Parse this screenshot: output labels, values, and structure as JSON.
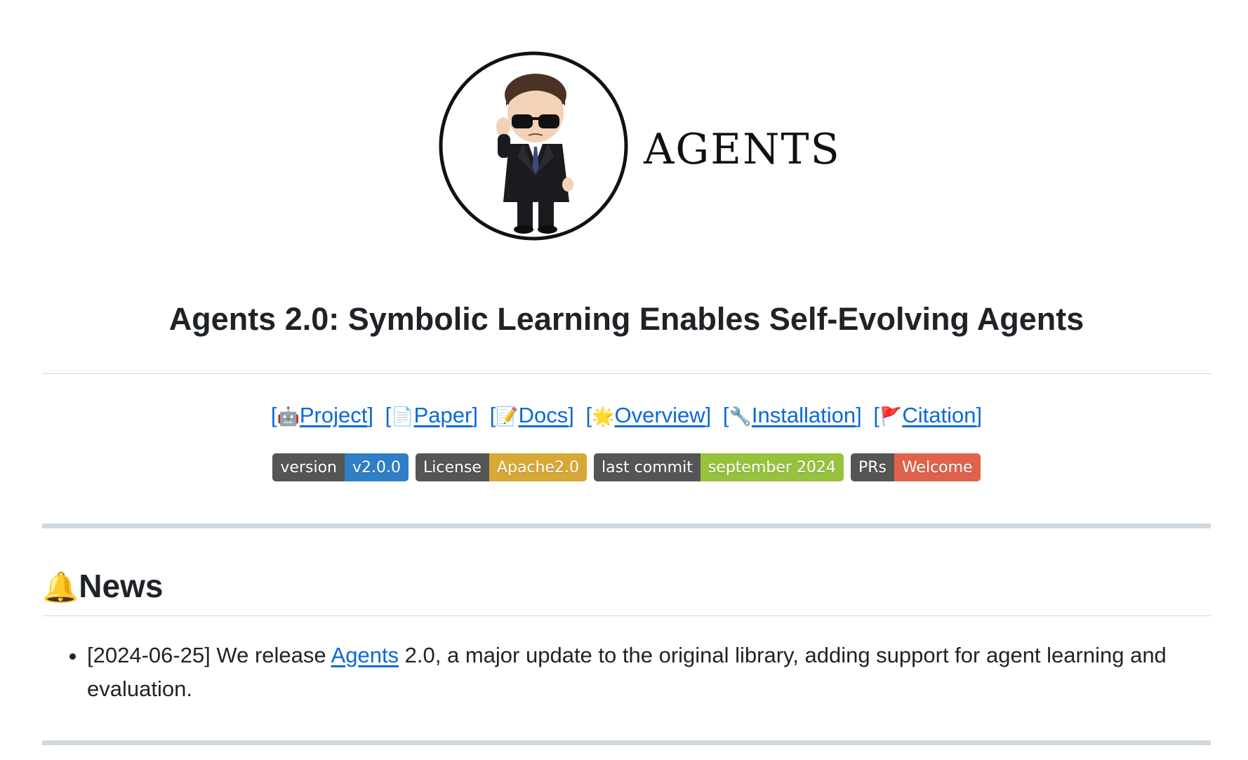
{
  "logo": {
    "wordmark": "AGENTS"
  },
  "title": "Agents 2.0: Symbolic Learning Enables Self-Evolving Agents",
  "links": [
    {
      "icon": "🤖",
      "icon_name": "robot-icon",
      "label": "Project"
    },
    {
      "icon": "📄",
      "icon_name": "page-icon",
      "label": "Paper"
    },
    {
      "icon": "📝",
      "icon_name": "memo-icon",
      "label": "Docs"
    },
    {
      "icon": "🌟",
      "icon_name": "star-icon",
      "label": "Overview"
    },
    {
      "icon": "🔧",
      "icon_name": "wrench-icon",
      "label": "Installation"
    },
    {
      "icon": "🚩",
      "icon_name": "flag-icon",
      "label": "Citation"
    }
  ],
  "badges": [
    {
      "label": "version",
      "value": "v2.0.0",
      "color": "#2f7ec6"
    },
    {
      "label": "License",
      "value": "Apache2.0",
      "color": "#d8a834"
    },
    {
      "label": "last commit",
      "value": "september 2024",
      "color": "#97c23d"
    },
    {
      "label": "PRs",
      "value": "Welcome",
      "color": "#e0624a"
    }
  ],
  "news": {
    "icon": "🔔",
    "heading": "News",
    "items": [
      {
        "prefix": "[2024-06-25] We release ",
        "link": "Agents",
        "suffix": " 2.0, a major update to the original library, adding support for agent learning and evaluation."
      }
    ]
  },
  "colors": {
    "link": "#0969da",
    "text": "#1f2328",
    "rule": "#d1d9e0"
  }
}
